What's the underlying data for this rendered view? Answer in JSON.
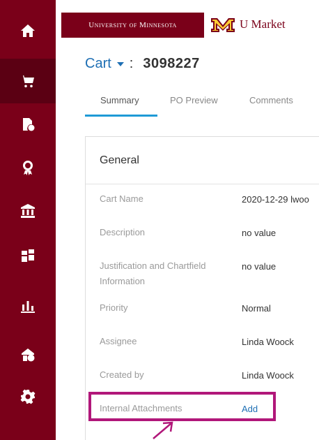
{
  "header": {
    "university_name": "University of Minnesota",
    "app_name": "U Market"
  },
  "sidebar": {
    "items": [
      {
        "icon": "home-icon",
        "active": false
      },
      {
        "icon": "cart-icon",
        "active": true
      },
      {
        "icon": "documents-icon",
        "active": false
      },
      {
        "icon": "award-icon",
        "active": false
      },
      {
        "icon": "institution-icon",
        "active": false
      },
      {
        "icon": "suppliers-icon",
        "active": false
      },
      {
        "icon": "bar-chart-icon",
        "active": false
      },
      {
        "icon": "admin-icon",
        "active": false
      },
      {
        "icon": "gear-icon",
        "active": false
      }
    ]
  },
  "cart": {
    "label": "Cart",
    "colon": ":",
    "number": "3098227"
  },
  "tabs": [
    {
      "label": "Summary",
      "active": true
    },
    {
      "label": "PO Preview",
      "active": false
    },
    {
      "label": "Comments",
      "active": false
    }
  ],
  "general": {
    "title": "General",
    "fields": [
      {
        "label": "Cart Name",
        "value": "2020-12-29 lwoo"
      },
      {
        "label": "Description",
        "value": "no value"
      },
      {
        "label": "Justification and Chartfield Information",
        "value": "no value"
      },
      {
        "label": "Priority",
        "value": "Normal"
      },
      {
        "label": "Assignee",
        "value": "Linda Woock"
      },
      {
        "label": "Created by",
        "value": "Linda Woock"
      },
      {
        "label": "Internal Attachments",
        "value": "Add"
      }
    ]
  },
  "colors": {
    "brand_maroon": "#7a0019",
    "link_blue": "#1e6fb4",
    "tab_underline": "#1f9ad6",
    "highlight_magenta": "#b1177a"
  }
}
